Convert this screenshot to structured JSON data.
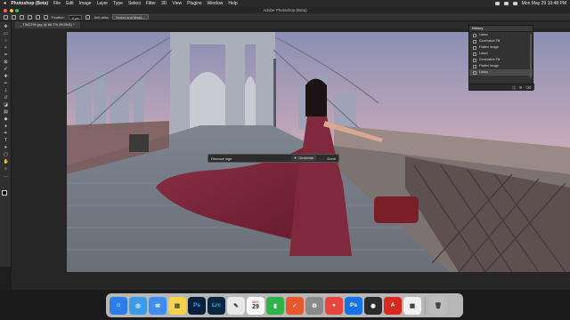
{
  "menubar": {
    "app_name": "Photoshop (Beta)",
    "items": [
      "File",
      "Edit",
      "Image",
      "Layer",
      "Type",
      "Select",
      "Filter",
      "3D",
      "View",
      "Plugins",
      "Window",
      "Help"
    ],
    "clock": "Mon May 29  10:48 PM"
  },
  "window": {
    "title": "Adobe Photoshop (Beta)"
  },
  "options_bar": {
    "feather_label": "Feather:",
    "feather_value": "0 px",
    "anti_alias": "Anti-alias",
    "select_mask": "Select and Mask..."
  },
  "document_tab": {
    "label": "_TIM2290.jpg @ 66.7% (RGB/8) *"
  },
  "contextual_bar": {
    "prompt_text": "Remove sign",
    "generate_label": "Generate",
    "more_label": "...",
    "done_label": "Done"
  },
  "history_panel": {
    "title": "History",
    "items": [
      {
        "label": "Lasso",
        "selected": false
      },
      {
        "label": "Generative Fill",
        "selected": false
      },
      {
        "label": "Flatten Image",
        "selected": false
      },
      {
        "label": "Lasso",
        "selected": false
      },
      {
        "label": "Generative Fill",
        "selected": false
      },
      {
        "label": "Flatten Image",
        "selected": false
      },
      {
        "label": "Lasso",
        "selected": true
      }
    ]
  },
  "dock": {
    "apps": [
      {
        "name": "finder-icon",
        "glyph": "☺",
        "color": "#2b7de9"
      },
      {
        "name": "safari-icon",
        "glyph": "◎",
        "color": "#3a9be8"
      },
      {
        "name": "mail-icon",
        "glyph": "✉",
        "color": "#3d8ef0"
      },
      {
        "name": "notes-icon",
        "glyph": "▤",
        "color": "#f5d24a"
      },
      {
        "name": "photoshop-icon",
        "glyph": "Ps",
        "color": "#0a1f3c"
      },
      {
        "name": "lightroom-classic-icon",
        "glyph": "Lrc",
        "color": "#0b2540"
      },
      {
        "name": "pencil-app-icon",
        "glyph": "✎",
        "color": "#e8e8e8"
      },
      {
        "name": "calendar-icon",
        "glyph": "29",
        "color": "#ffffff"
      },
      {
        "name": "numbers-icon",
        "glyph": "▮",
        "color": "#2fb24a"
      },
      {
        "name": "reminder-app-icon",
        "glyph": "✓",
        "color": "#e8572b"
      },
      {
        "name": "settings-icon",
        "glyph": "⚙",
        "color": "#8a8a8a"
      },
      {
        "name": "chrome-icon",
        "glyph": "●",
        "color": "#e8453c"
      },
      {
        "name": "photoshop-beta-icon",
        "glyph": "Ps",
        "color": "#1473e6"
      },
      {
        "name": "camera-app-icon",
        "glyph": "◉",
        "color": "#2b2b2b"
      },
      {
        "name": "acrobat-icon",
        "glyph": "A",
        "color": "#d9281e"
      },
      {
        "name": "preview-icon",
        "glyph": "▦",
        "color": "#f0f0f0"
      },
      {
        "name": "trash-icon",
        "glyph": "🗑",
        "color": "#bdbdbd"
      }
    ],
    "calendar_month": "MAY",
    "calendar_day": "29"
  }
}
